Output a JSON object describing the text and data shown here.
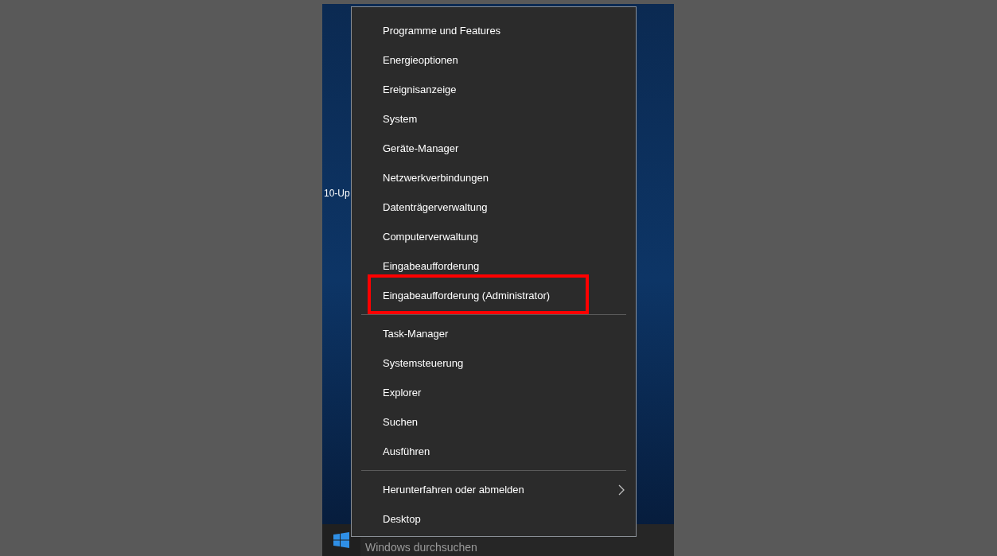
{
  "desktop_label": "10-Up",
  "menu": {
    "groups": [
      {
        "items": [
          {
            "label": "Programme und Features",
            "kind": "item",
            "highlighted": false
          },
          {
            "label": "Energieoptionen",
            "kind": "item",
            "highlighted": false
          },
          {
            "label": "Ereignisanzeige",
            "kind": "item",
            "highlighted": false
          },
          {
            "label": "System",
            "kind": "item",
            "highlighted": false
          },
          {
            "label": "Geräte-Manager",
            "kind": "item",
            "highlighted": false
          },
          {
            "label": "Netzwerkverbindungen",
            "kind": "item",
            "highlighted": false
          },
          {
            "label": "Datenträgerverwaltung",
            "kind": "item",
            "highlighted": false
          },
          {
            "label": "Computerverwaltung",
            "kind": "item",
            "highlighted": false
          },
          {
            "label": "Eingabeaufforderung",
            "kind": "item",
            "highlighted": false
          },
          {
            "label": "Eingabeaufforderung (Administrator)",
            "kind": "item",
            "highlighted": true
          }
        ]
      },
      {
        "items": [
          {
            "label": "Task-Manager",
            "kind": "item",
            "highlighted": false
          },
          {
            "label": "Systemsteuerung",
            "kind": "item",
            "highlighted": false
          },
          {
            "label": "Explorer",
            "kind": "item",
            "highlighted": false
          },
          {
            "label": "Suchen",
            "kind": "item",
            "highlighted": false
          },
          {
            "label": "Ausführen",
            "kind": "item",
            "highlighted": false
          }
        ]
      },
      {
        "items": [
          {
            "label": "Herunterfahren oder abmelden",
            "kind": "submenu",
            "highlighted": false
          },
          {
            "label": "Desktop",
            "kind": "item",
            "highlighted": false
          }
        ]
      }
    ]
  },
  "taskbar": {
    "search": {
      "placeholder": "Windows durchsuchen"
    }
  }
}
